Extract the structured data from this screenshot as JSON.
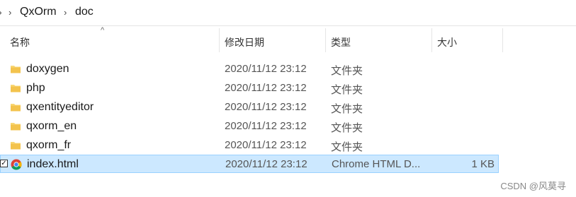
{
  "breadcrumb": {
    "items": [
      "QxOrm",
      "doc"
    ]
  },
  "columns": {
    "name": "名称",
    "date": "修改日期",
    "type": "类型",
    "size": "大小"
  },
  "files": [
    {
      "name": "doxygen",
      "date": "2020/11/12 23:12",
      "type": "文件夹",
      "size": "",
      "icon": "folder-icon"
    },
    {
      "name": "php",
      "date": "2020/11/12 23:12",
      "type": "文件夹",
      "size": "",
      "icon": "folder-icon"
    },
    {
      "name": "qxentityeditor",
      "date": "2020/11/12 23:12",
      "type": "文件夹",
      "size": "",
      "icon": "folder-icon"
    },
    {
      "name": "qxorm_en",
      "date": "2020/11/12 23:12",
      "type": "文件夹",
      "size": "",
      "icon": "folder-icon"
    },
    {
      "name": "qxorm_fr",
      "date": "2020/11/12 23:12",
      "type": "文件夹",
      "size": "",
      "icon": "folder-icon"
    },
    {
      "name": "index.html",
      "date": "2020/11/12 23:12",
      "type": "Chrome HTML D...",
      "size": "1 KB",
      "icon": "chrome-icon",
      "selected": true
    }
  ],
  "watermark": "CSDN @风莫寻",
  "colors": {
    "selection_bg": "#cce8ff",
    "selection_border": "#99d1ff",
    "folder": "#f8d775"
  }
}
